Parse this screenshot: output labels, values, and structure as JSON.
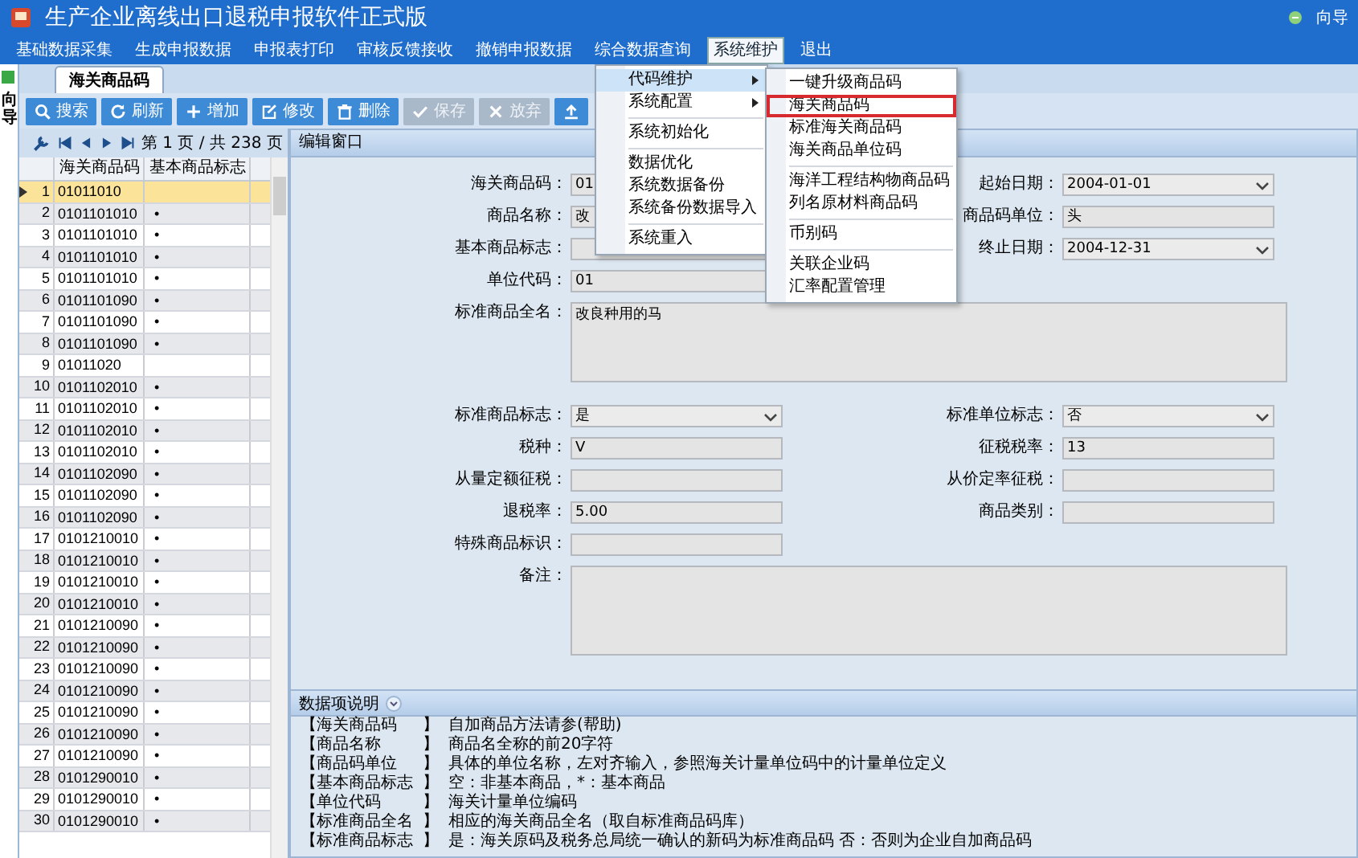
{
  "window": {
    "title": "生产企业离线出口退税申报软件正式版",
    "guide": "向导"
  },
  "menu_bar": [
    {
      "label": "基础数据采集",
      "selected": false
    },
    {
      "label": "生成申报数据",
      "selected": false
    },
    {
      "label": "申报表打印",
      "selected": false
    },
    {
      "label": "审核反馈接收",
      "selected": false
    },
    {
      "label": "撤销申报数据",
      "selected": false
    },
    {
      "label": "综合数据查询",
      "selected": false
    },
    {
      "label": "系统维护",
      "selected": true
    },
    {
      "label": "退出",
      "selected": false
    }
  ],
  "side_strip": {
    "label": "向导"
  },
  "tabs": [
    {
      "label": "海关商品码",
      "selected": true
    }
  ],
  "toolbar": [
    {
      "kind": "search",
      "label": "搜索",
      "disabled": false
    },
    {
      "kind": "refresh",
      "label": "刷新",
      "disabled": false
    },
    {
      "kind": "add",
      "label": "增加",
      "disabled": false
    },
    {
      "kind": "edit",
      "label": "修改",
      "disabled": false
    },
    {
      "kind": "delete",
      "label": "删除",
      "disabled": false
    },
    {
      "kind": "save",
      "label": "保存",
      "disabled": true
    },
    {
      "kind": "cancel",
      "label": "放弃",
      "disabled": true
    },
    {
      "kind": "upload",
      "disabled": false
    }
  ],
  "pager": {
    "text": "第 1 页 / 共 238 页"
  },
  "table": {
    "columns": [
      "海关商品码",
      "基本商品标志"
    ],
    "rows": [
      {
        "number": "1",
        "code": "01011010",
        "selected": true
      },
      {
        "number": "2",
        "code": "0101101010",
        "flag": "•",
        "selected": false
      },
      {
        "number": "3",
        "code": "0101101010",
        "flag": "•",
        "selected": false
      },
      {
        "number": "4",
        "code": "0101101010",
        "flag": "•",
        "selected": false
      },
      {
        "number": "5",
        "code": "0101101010",
        "flag": "•",
        "selected": false
      },
      {
        "number": "6",
        "code": "0101101090",
        "flag": "•",
        "selected": false
      },
      {
        "number": "7",
        "code": "0101101090",
        "flag": "•",
        "selected": false
      },
      {
        "number": "8",
        "code": "0101101090",
        "flag": "•",
        "selected": false
      },
      {
        "number": "9",
        "code": "01011020",
        "selected": false
      },
      {
        "number": "10",
        "code": "0101102010",
        "flag": "•",
        "selected": false
      },
      {
        "number": "11",
        "code": "0101102010",
        "flag": "•",
        "selected": false
      },
      {
        "number": "12",
        "code": "0101102010",
        "flag": "•",
        "selected": false
      },
      {
        "number": "13",
        "code": "0101102010",
        "flag": "•",
        "selected": false
      },
      {
        "number": "14",
        "code": "0101102090",
        "flag": "•",
        "selected": false
      },
      {
        "number": "15",
        "code": "0101102090",
        "flag": "•",
        "selected": false
      },
      {
        "number": "16",
        "code": "0101102090",
        "flag": "•",
        "selected": false
      },
      {
        "number": "17",
        "code": "0101210010",
        "flag": "•",
        "selected": false
      },
      {
        "number": "18",
        "code": "0101210010",
        "flag": "•",
        "selected": false
      },
      {
        "number": "19",
        "code": "0101210010",
        "flag": "•",
        "selected": false
      },
      {
        "number": "20",
        "code": "0101210010",
        "flag": "•",
        "selected": false
      },
      {
        "number": "21",
        "code": "0101210090",
        "flag": "•",
        "selected": false
      },
      {
        "number": "22",
        "code": "0101210090",
        "flag": "•",
        "selected": false
      },
      {
        "number": "23",
        "code": "0101210090",
        "flag": "•",
        "selected": false
      },
      {
        "number": "24",
        "code": "0101210090",
        "flag": "•",
        "selected": false
      },
      {
        "number": "25",
        "code": "0101210090",
        "flag": "•",
        "selected": false
      },
      {
        "number": "26",
        "code": "0101210090",
        "flag": "•",
        "selected": false
      },
      {
        "number": "27",
        "code": "0101210090",
        "flag": "•",
        "selected": false
      },
      {
        "number": "28",
        "code": "0101290010",
        "flag": "•",
        "selected": false
      },
      {
        "number": "29",
        "code": "0101290010",
        "flag": "•",
        "selected": false
      },
      {
        "number": "30",
        "code": "0101290010",
        "flag": "•",
        "selected": false
      }
    ]
  },
  "editor": {
    "title": "编辑窗口",
    "rows": [
      [
        {
          "label": "海关商品码：",
          "kind": "text",
          "value": "01"
        },
        {
          "label": "起始日期：",
          "kind": "select",
          "value": "2004-01-01"
        }
      ],
      [
        {
          "label": "商品名称：",
          "kind": "text",
          "value": "改"
        },
        {
          "label": "商品码单位：",
          "kind": "text",
          "value": "头"
        }
      ],
      [
        {
          "label": "基本商品标志：",
          "kind": "text"
        },
        {
          "label": "终止日期：",
          "kind": "select",
          "value": "2004-12-31"
        }
      ],
      [
        {
          "label": "单位代码：",
          "kind": "text",
          "value": "01"
        }
      ],
      [
        {
          "label": "标准商品全名：",
          "kind": "area",
          "value": "改良种用的马"
        }
      ],
      [
        {
          "label": "标准商品标志：",
          "kind": "select",
          "value": "是"
        },
        {
          "label": "标准单位标志：",
          "kind": "select",
          "value": "否"
        }
      ],
      [
        {
          "label": "税种：",
          "kind": "text",
          "value": "V"
        },
        {
          "label": "征税税率：",
          "kind": "text",
          "value": "13"
        }
      ],
      [
        {
          "label": "从量定额征税：",
          "kind": "text"
        },
        {
          "label": "从价定率征税：",
          "kind": "text"
        }
      ],
      [
        {
          "label": "退税率：",
          "kind": "text",
          "value": "5.00"
        },
        {
          "label": "商品类别：",
          "kind": "text"
        }
      ],
      [
        {
          "label": "特殊商品标识：",
          "kind": "text"
        }
      ],
      [
        {
          "label": "备注：",
          "kind": "area"
        }
      ]
    ]
  },
  "help": {
    "title": "数据项说明",
    "lines": [
      {
        "label": "【海关商品码",
        "mark": "】",
        "text": "自加商品方法请参(帮助)"
      },
      {
        "label": "【商品名称",
        "mark": "】",
        "text": "商品名全称的前20字符"
      },
      {
        "label": "【商品码单位",
        "mark": "】",
        "text": "具体的单位名称，左对齐输入，参照海关计量单位码中的计量单位定义"
      },
      {
        "label": "【基本商品标志",
        "mark": "】",
        "text": "空：非基本商品，*：基本商品"
      },
      {
        "label": "【单位代码",
        "mark": "】",
        "text": "海关计量单位编码"
      },
      {
        "label": "【标准商品全名",
        "mark": "】",
        "text": "相应的海关商品全名（取自标准商品码库）"
      },
      {
        "label": "【标准商品标志",
        "mark": "】",
        "text": "是：海关原码及税务总局统一确认的新码为标准商品码 否：否则为企业自加商品码"
      }
    ]
  },
  "dropdown": {
    "items": [
      {
        "kind": "submenu",
        "label": "代码维护",
        "selected": true
      },
      {
        "kind": "submenu",
        "label": "系统配置",
        "selected": false
      },
      {
        "kind": "separator"
      },
      {
        "kind": "item",
        "label": "系统初始化",
        "selected": false
      },
      {
        "kind": "separator"
      },
      {
        "kind": "item",
        "label": "数据优化",
        "selected": false
      },
      {
        "kind": "item",
        "label": "系统数据备份",
        "selected": false
      },
      {
        "kind": "item",
        "label": "系统备份数据导入",
        "selected": false
      },
      {
        "kind": "separator"
      },
      {
        "kind": "item",
        "label": "系统重入",
        "selected": false
      }
    ]
  },
  "submenu": {
    "items": [
      {
        "kind": "item",
        "label": "一键升级商品码",
        "selected": false
      },
      {
        "kind": "item",
        "label": "海关商品码",
        "selected": true
      },
      {
        "kind": "item",
        "label": "标准海关商品码",
        "selected": false
      },
      {
        "kind": "item",
        "label": "海关商品单位码",
        "selected": false
      },
      {
        "kind": "separator"
      },
      {
        "kind": "item",
        "label": "海洋工程结构物商品码",
        "selected": false
      },
      {
        "kind": "item",
        "label": "列名原材料商品码",
        "selected": false
      },
      {
        "kind": "separator"
      },
      {
        "kind": "item",
        "label": "币别码",
        "selected": false
      },
      {
        "kind": "separator"
      },
      {
        "kind": "item",
        "label": "关联企业码",
        "selected": false
      },
      {
        "kind": "item",
        "label": "汇率配置管理",
        "selected": false
      }
    ]
  }
}
